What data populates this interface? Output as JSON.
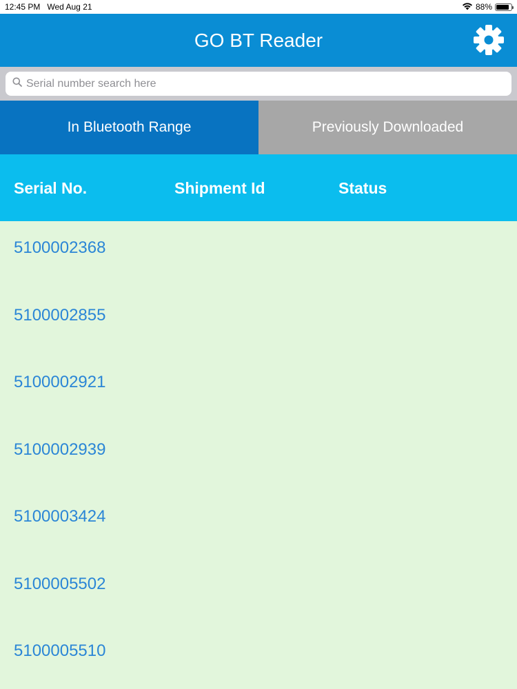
{
  "status_bar": {
    "time": "12:45 PM",
    "date": "Wed Aug 21",
    "battery_text": "88%",
    "battery_level": 0.88
  },
  "nav": {
    "title": "GO BT Reader",
    "settings_icon": "gear-icon"
  },
  "search": {
    "placeholder": "Serial number search here",
    "value": ""
  },
  "tabs": [
    {
      "label": "In Bluetooth Range",
      "active": true
    },
    {
      "label": "Previously Downloaded",
      "active": false
    }
  ],
  "table": {
    "headers": {
      "serial": "Serial No.",
      "shipment": "Shipment Id",
      "status": "Status"
    },
    "rows": [
      {
        "serial": "5100002368",
        "shipment": "",
        "status": ""
      },
      {
        "serial": "5100002855",
        "shipment": "",
        "status": ""
      },
      {
        "serial": "5100002921",
        "shipment": "",
        "status": ""
      },
      {
        "serial": "5100002939",
        "shipment": "",
        "status": ""
      },
      {
        "serial": "5100003424",
        "shipment": "",
        "status": ""
      },
      {
        "serial": "5100005502",
        "shipment": "",
        "status": ""
      },
      {
        "serial": "5100005510",
        "shipment": "",
        "status": ""
      }
    ]
  },
  "colors": {
    "nav_bg": "#0a8dd4",
    "tab_active": "#0873c1",
    "tab_inactive": "#a7a7a7",
    "header_bg": "#0bbdee",
    "row_bg": "#e2f6dc",
    "serial_text": "#2b86d6"
  }
}
